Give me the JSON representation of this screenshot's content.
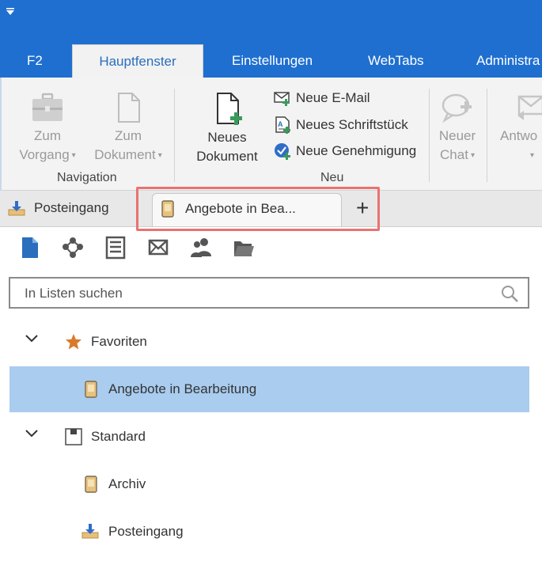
{
  "ribbon_tabs": [
    {
      "label": "F2"
    },
    {
      "label": "Hauptfenster"
    },
    {
      "label": "Einstellungen"
    },
    {
      "label": "WebTabs"
    },
    {
      "label": "Administra"
    }
  ],
  "ribbon": {
    "navigation": {
      "label": "Navigation",
      "zum_vorgang": {
        "line1": "Zum",
        "line2": "Vorgang"
      },
      "zum_dokument": {
        "line1": "Zum",
        "line2": "Dokument"
      }
    },
    "neu": {
      "label": "Neu",
      "neues_dokument": {
        "line1": "Neues",
        "line2": "Dokument"
      },
      "neue_email": "Neue E-Mail",
      "neues_schriftstueck": "Neues Schriftstück",
      "neue_genehmigung": "Neue Genehmigung"
    },
    "neuer_chat": {
      "line1": "Neuer",
      "line2": "Chat"
    },
    "antworten": {
      "line1": "Antwo"
    }
  },
  "doc_tabs": {
    "posteingang": "Posteingang",
    "angebote": "Angebote in Bea..."
  },
  "search": {
    "placeholder": "In Listen suchen"
  },
  "tree": {
    "favoriten": "Favoriten",
    "angebote_in_bearbeitung": "Angebote in Bearbeitung",
    "standard": "Standard",
    "archiv": "Archiv",
    "posteingang": "Posteingang"
  },
  "icons": [
    "quick-access-arrow-icon",
    "briefcase-icon",
    "document-icon",
    "new-document-icon",
    "email-icon",
    "letter-icon",
    "approval-check-icon",
    "chat-icon",
    "reply-icon",
    "inbox-icon",
    "folder-binder-icon",
    "plus-icon",
    "search-icon",
    "chevron-down-icon",
    "star-icon",
    "standard-list-icon"
  ],
  "colors": {
    "accent": "#1f6fd0",
    "selection": "#a9ccef",
    "highlight": "#e97272",
    "star": "#d97a2b"
  }
}
